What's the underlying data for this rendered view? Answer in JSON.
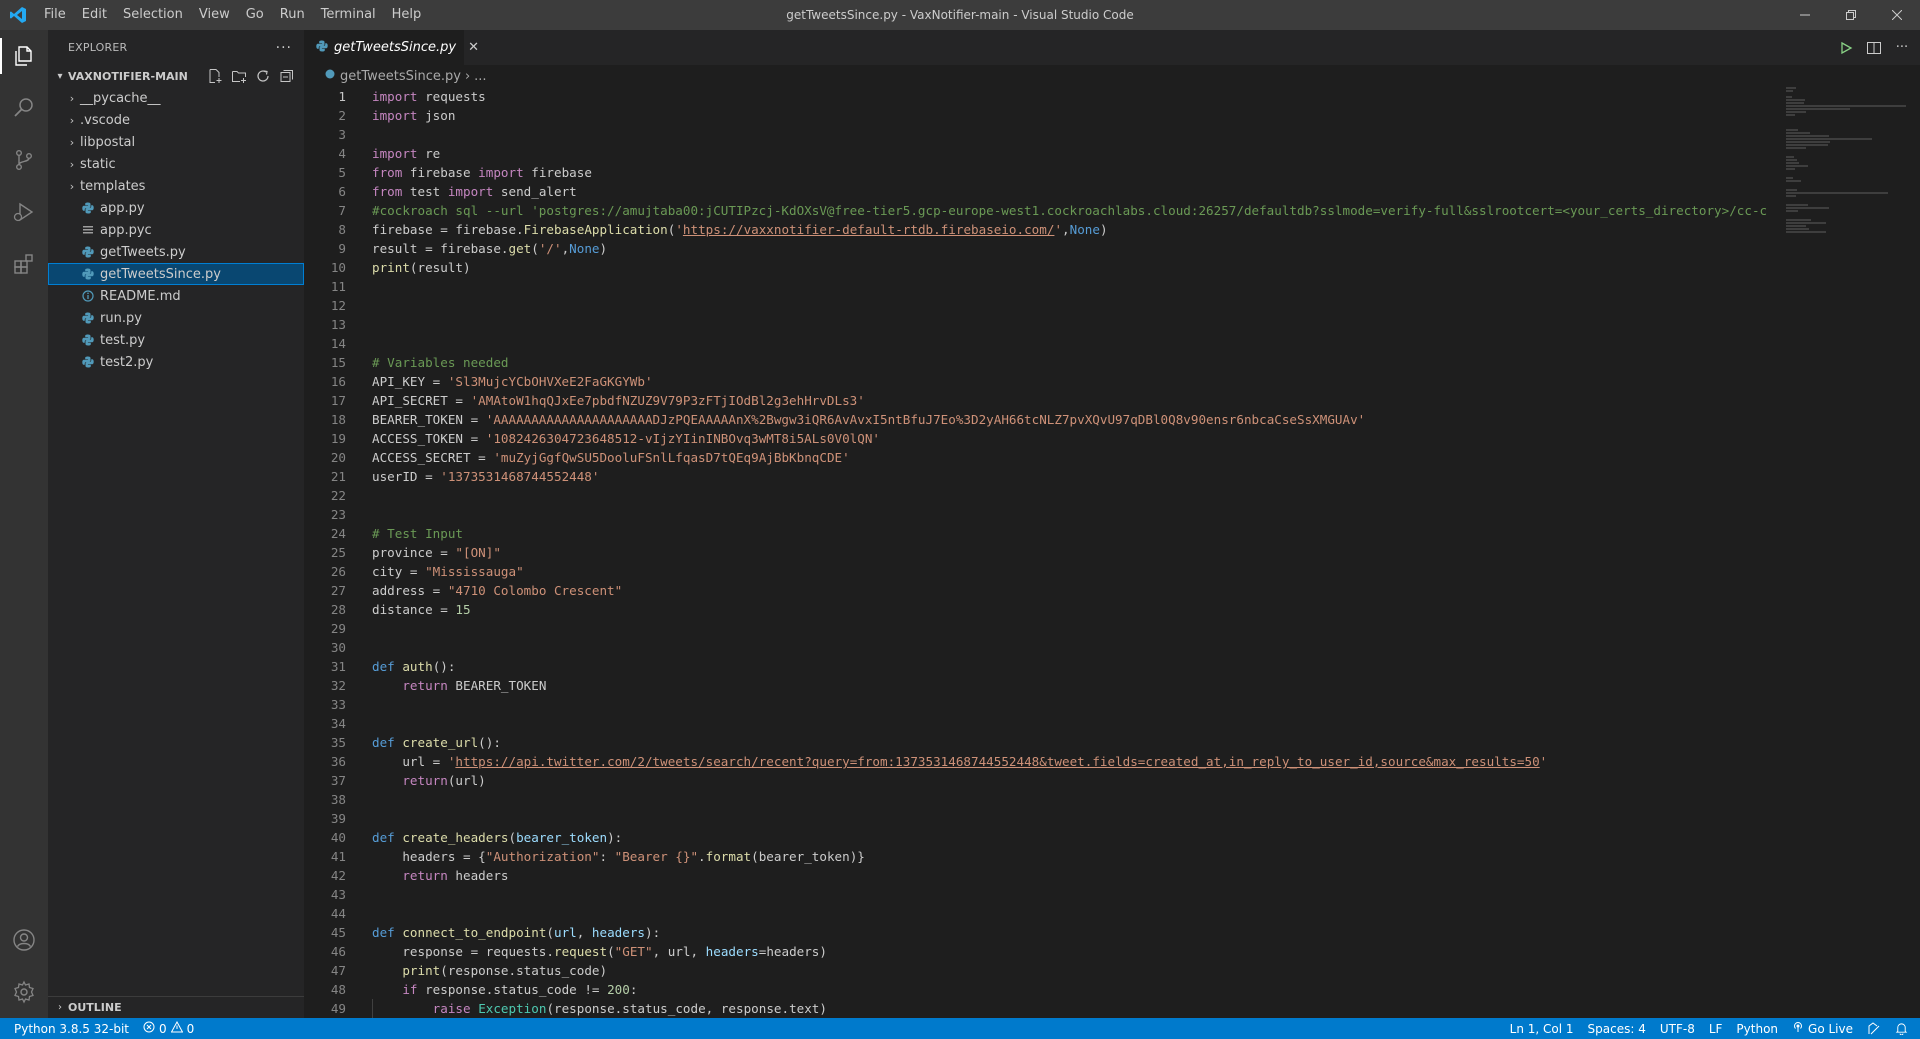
{
  "window": {
    "title": "getTweetsSince.py - VaxNotifier-main - Visual Studio Code"
  },
  "menu": [
    "File",
    "Edit",
    "Selection",
    "View",
    "Go",
    "Run",
    "Terminal",
    "Help"
  ],
  "sidebar": {
    "title": "EXPLORER",
    "folder": "VAXNOTIFIER-MAIN",
    "items": [
      {
        "label": "__pycache__",
        "type": "folder"
      },
      {
        "label": ".vscode",
        "type": "folder"
      },
      {
        "label": "libpostal",
        "type": "folder"
      },
      {
        "label": "static",
        "type": "folder"
      },
      {
        "label": "templates",
        "type": "folder"
      },
      {
        "label": "app.py",
        "type": "python"
      },
      {
        "label": "app.pyc",
        "type": "pyc"
      },
      {
        "label": "getTweets.py",
        "type": "python"
      },
      {
        "label": "getTweetsSince.py",
        "type": "python",
        "selected": true
      },
      {
        "label": "README.md",
        "type": "info"
      },
      {
        "label": "run.py",
        "type": "python"
      },
      {
        "label": "test.py",
        "type": "python"
      },
      {
        "label": "test2.py",
        "type": "python"
      }
    ],
    "outline_label": "OUTLINE"
  },
  "editor": {
    "tab_label": "getTweetsSince.py",
    "breadcrumb_file": "getTweetsSince.py",
    "breadcrumb_more": "...",
    "current_line": 1,
    "lines": [
      "import requests",
      "import json",
      "",
      "import re",
      "from firebase import firebase",
      "from test import send_alert",
      "#cockroach sql --url 'postgres://amujtaba00:jCUTIPzcj-KdOXsV@free-tier5.gcp-europe-west1.cockroachlabs.cloud:26257/defaultdb?sslmode=verify-full&sslrootcert=<your_certs_directory>/cc-c",
      "firebase = firebase.FirebaseApplication('https://vaxxnotifier-default-rtdb.firebaseio.com/',None)",
      "result = firebase.get('/',None)",
      "print(result)",
      "",
      "",
      "",
      "",
      "# Variables needed",
      "API_KEY = 'Sl3MujcYCbOHVXeE2FaGKGYWb'",
      "API_SECRET = 'AMAtoW1hqQJxEe7pbdfNZUZ9V79P3zFTjIOdBl2g3ehHrvDLs3'",
      "BEARER_TOKEN = 'AAAAAAAAAAAAAAAAAAAAADJzPQEAAAAAnX%2Bwgw3iQR6AvAvxI5ntBfuJ7Eo%3D2yAH66tcNLZ7pvXQvU97qDBl0Q8v90ensr6nbcaCseSsXMGUAv'",
      "ACCESS_TOKEN = '1082426304723648512-vIjzYIinINBOvq3wMT8i5ALs0V0lQN'",
      "ACCESS_SECRET = 'muZyjGgfQwSU5DooluFSnlLfqasD7tQEq9AjBbKbnqCDE'",
      "userID = '1373531468744552448'",
      "",
      "",
      "# Test Input",
      "province = \"[ON]\"",
      "city = \"Mississauga\"",
      "address = \"4710 Colombo Crescent\"",
      "distance = 15",
      "",
      "",
      "def auth():",
      "    return BEARER_TOKEN",
      "",
      "",
      "def create_url():",
      "    url = 'https://api.twitter.com/2/tweets/search/recent?query=from:1373531468744552448&tweet.fields=created_at,in_reply_to_user_id,source&max_results=50'",
      "    return(url)",
      "",
      "",
      "def create_headers(bearer_token):",
      "    headers = {\"Authorization\": \"Bearer {}\".format(bearer_token)}",
      "    return headers",
      "",
      "",
      "def connect_to_endpoint(url, headers):",
      "    response = requests.request(\"GET\", url, headers=headers)",
      "    print(response.status_code)",
      "    if response.status_code != 200:",
      "        raise Exception(response.status_code, response.text)"
    ]
  },
  "status": {
    "interpreter": "Python 3.8.5 32-bit",
    "errors": "0",
    "warnings": "0",
    "position": "Ln 1, Col 1",
    "spaces": "Spaces: 4",
    "encoding": "UTF-8",
    "eol": "LF",
    "language": "Python",
    "golive": "Go Live"
  },
  "colors": {
    "statusbar": "#007acc",
    "activitybar": "#333333",
    "sidebar": "#252526",
    "editor": "#1e1e1e",
    "selection": "#094771"
  }
}
